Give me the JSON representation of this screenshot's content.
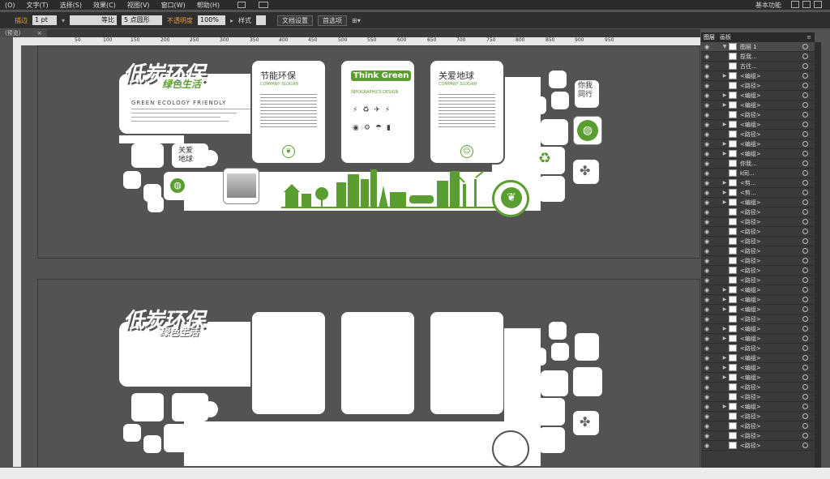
{
  "menu": [
    "(O)",
    "文字(T)",
    "选择(S)",
    "效果(C)",
    "视图(V)",
    "窗口(W)",
    "帮助(H)"
  ],
  "workspace": "基本功能",
  "control": {
    "stroke_label": "描边",
    "stroke_value": "1 pt",
    "stroke_profile": "等比",
    "brush": "5 点圆形",
    "opacity_label": "不透明度",
    "opacity_value": "100%",
    "style_label": "样式",
    "doc_setup": "文档设置",
    "preferences": "首选项"
  },
  "tab": "(预览)",
  "ruler_ticks": [
    "50",
    "100",
    "150",
    "200",
    "250",
    "300",
    "350",
    "400",
    "450",
    "500",
    "550",
    "600",
    "650",
    "700",
    "750",
    "800",
    "850",
    "900",
    "950"
  ],
  "artboard1": {
    "headline": "低炭环保",
    "subhead": "绿色生活",
    "english": "GREEN ECOLOGY FRIENDLY",
    "panel1_title": "节能环保",
    "panel1_slogan": "COMPANY SLOGAN",
    "panel2_title": "Think Green",
    "panel2_sub": "INFOGRAPHICS DESIGN",
    "panel3_title": "关爱地球",
    "panel3_slogan": "COMPANY SLOGAN",
    "side1": "关爱地球",
    "side2": "你我同行"
  },
  "artboard2": {
    "headline": "低炭环保",
    "subhead": "绿色生活"
  },
  "panel": {
    "tabs": [
      "图层",
      "画板"
    ],
    "layers": [
      {
        "name": "图层 1",
        "arrow": "▼"
      },
      {
        "name": "揽我...",
        "arrow": ""
      },
      {
        "name": "古往...",
        "arrow": ""
      },
      {
        "name": "<编组>",
        "arrow": "▶"
      },
      {
        "name": "<路径>",
        "arrow": ""
      },
      {
        "name": "<编组>",
        "arrow": "▶"
      },
      {
        "name": "<编组>",
        "arrow": "▶"
      },
      {
        "name": "<路径>",
        "arrow": ""
      },
      {
        "name": "<编组>",
        "arrow": "▶"
      },
      {
        "name": "<路径>",
        "arrow": ""
      },
      {
        "name": "<编组>",
        "arrow": "▶"
      },
      {
        "name": "<编组>",
        "arrow": "▶"
      },
      {
        "name": "你我...",
        "arrow": ""
      },
      {
        "name": "k同...",
        "arrow": ""
      },
      {
        "name": "<剪...",
        "arrow": "▶"
      },
      {
        "name": "<剪...",
        "arrow": "▶"
      },
      {
        "name": "<编组>",
        "arrow": "▶"
      },
      {
        "name": "<路径>",
        "arrow": ""
      },
      {
        "name": "<路径>",
        "arrow": ""
      },
      {
        "name": "<路径>",
        "arrow": ""
      },
      {
        "name": "<路径>",
        "arrow": ""
      },
      {
        "name": "<路径>",
        "arrow": ""
      },
      {
        "name": "<路径>",
        "arrow": ""
      },
      {
        "name": "<路径>",
        "arrow": ""
      },
      {
        "name": "<路径>",
        "arrow": ""
      },
      {
        "name": "<编组>",
        "arrow": "▶"
      },
      {
        "name": "<编组>",
        "arrow": "▶"
      },
      {
        "name": "<编组>",
        "arrow": "▶"
      },
      {
        "name": "<路径>",
        "arrow": ""
      },
      {
        "name": "<编组>",
        "arrow": "▶"
      },
      {
        "name": "<编组>",
        "arrow": "▶"
      },
      {
        "name": "<路径>",
        "arrow": ""
      },
      {
        "name": "<编组>",
        "arrow": "▶"
      },
      {
        "name": "<编组>",
        "arrow": "▶"
      },
      {
        "name": "<编组>",
        "arrow": "▶"
      },
      {
        "name": "<路径>",
        "arrow": ""
      },
      {
        "name": "<路径>",
        "arrow": ""
      },
      {
        "name": "<编组>",
        "arrow": "▶"
      },
      {
        "name": "<路径>",
        "arrow": ""
      },
      {
        "name": "<路径>",
        "arrow": ""
      },
      {
        "name": "<路径>",
        "arrow": ""
      },
      {
        "name": "<路径>",
        "arrow": ""
      }
    ]
  },
  "colors": {
    "accent_green": "#5a9e32",
    "canvas": "#535353",
    "panel": "#3a3a3a"
  }
}
